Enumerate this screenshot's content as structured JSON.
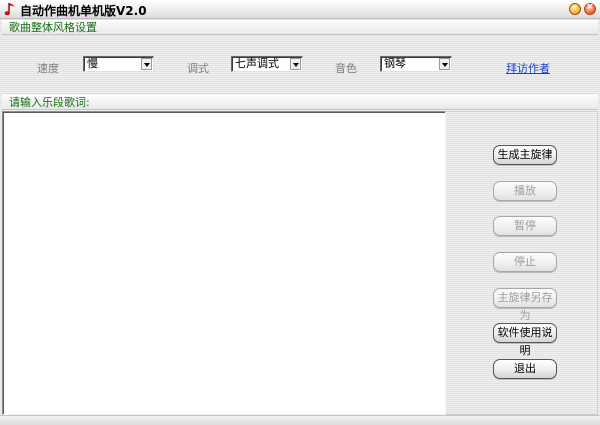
{
  "window": {
    "title": "自动作曲机单机版V2.0",
    "icon": "music-note-icon",
    "controls": {
      "minimize_glyph": "-",
      "close_glyph": "×"
    }
  },
  "style_section": {
    "header": "歌曲整体风格设置",
    "speed": {
      "label": "速度",
      "value": "慢"
    },
    "mode": {
      "label": "调式",
      "value": "七声调式"
    },
    "timbre": {
      "label": "音色",
      "value": "钢琴"
    },
    "visit_author_link": "拜访作者"
  },
  "lyrics_section": {
    "header": "请输入乐段歌词:",
    "text": ""
  },
  "buttons": {
    "generate": "生成主旋律",
    "play": "播放",
    "pause": "暂停",
    "stop": "停止",
    "save_as": "主旋律另存为",
    "help": "软件使用说明",
    "exit": "退出"
  },
  "colors": {
    "section_header_text": "#166e16",
    "link": "#1a3fc8",
    "disabled_text": "#9c9c9c"
  }
}
